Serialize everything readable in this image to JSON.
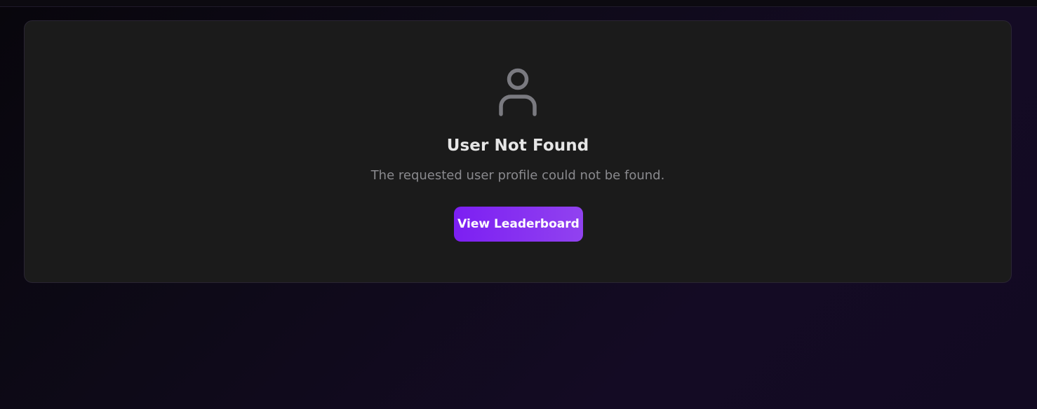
{
  "colors": {
    "background": "#0e0a18",
    "card_background": "#1b1b1b",
    "icon": "#7a7a80",
    "title": "#e6e6e6",
    "message": "#8a8a8e",
    "button_start": "#7c1ff2",
    "button_end": "#9142f0",
    "button_text": "#ffffff"
  },
  "empty_state": {
    "icon": "user-icon",
    "title": "User Not Found",
    "message": "The requested user profile could not be found.",
    "button_label": "View Leaderboard"
  }
}
